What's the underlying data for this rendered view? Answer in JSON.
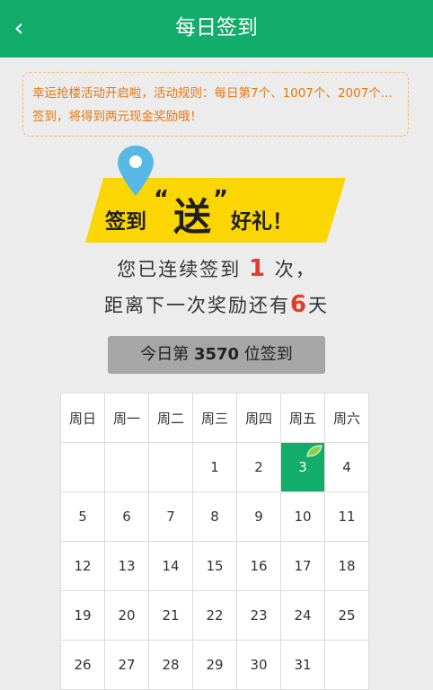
{
  "header": {
    "back_icon": "chevron-left-icon",
    "title": "每日签到"
  },
  "notice": {
    "text": "幸运抢楼活动开启啦，活动规则：每日第7个、1007个、2007个...签到，将得到两元现金奖励哦！"
  },
  "banner": {
    "part1": "签到",
    "quote_open": "“",
    "gift_char": "送",
    "quote_close": "”",
    "part2": "好礼！",
    "pin_icon": "location-pin-icon"
  },
  "streak": {
    "prefix": "您已连续签到",
    "count": "1",
    "suffix": "次，"
  },
  "next_reward": {
    "prefix": "距离下一次奖励还有",
    "days": "6",
    "suffix": "天"
  },
  "rank": {
    "prefix": "今日第",
    "number": "3570",
    "suffix": "位签到"
  },
  "calendar": {
    "weekdays": [
      "周日",
      "周一",
      "周二",
      "周三",
      "周四",
      "周五",
      "周六"
    ],
    "weeks": [
      [
        "",
        "",
        "",
        "1",
        "2",
        "3",
        "4"
      ],
      [
        "5",
        "6",
        "7",
        "8",
        "9",
        "10",
        "11"
      ],
      [
        "12",
        "13",
        "14",
        "15",
        "16",
        "17",
        "18"
      ],
      [
        "19",
        "20",
        "21",
        "22",
        "23",
        "24",
        "25"
      ],
      [
        "26",
        "27",
        "28",
        "29",
        "30",
        "31",
        ""
      ]
    ],
    "today": "3",
    "today_icon": "leaf-icon"
  },
  "colors": {
    "brand": "#12ad6a",
    "highlight": "#e53b2a",
    "notice": "#e8780f",
    "banner": "#fbd602"
  }
}
